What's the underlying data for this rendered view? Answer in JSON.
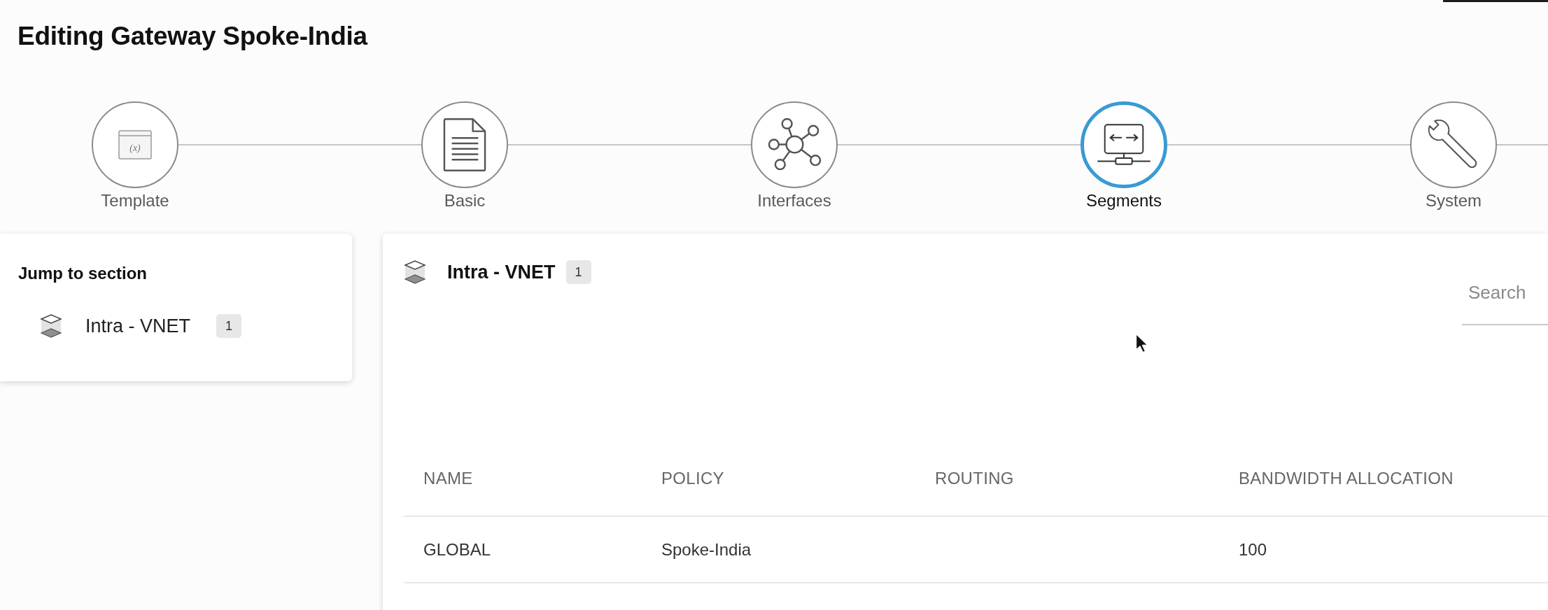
{
  "page": {
    "title": "Editing Gateway Spoke-India"
  },
  "steps": [
    {
      "label": "Template",
      "selected": false,
      "icon_text": "(x)"
    },
    {
      "label": "Basic",
      "selected": false
    },
    {
      "label": "Interfaces",
      "selected": false
    },
    {
      "label": "Segments",
      "selected": true
    },
    {
      "label": "System",
      "selected": false
    }
  ],
  "jump_panel": {
    "title": "Jump to section",
    "items": [
      {
        "label": "Intra - VNET",
        "count": "1"
      }
    ]
  },
  "section": {
    "title": "Intra - VNET",
    "count": "1",
    "search": {
      "placeholder": "Search"
    },
    "table": {
      "columns": [
        "NAME",
        "POLICY",
        "ROUTING",
        "BANDWIDTH ALLOCATION"
      ],
      "rows": [
        [
          "GLOBAL",
          "Spoke-India",
          null,
          "100"
        ]
      ]
    }
  }
}
